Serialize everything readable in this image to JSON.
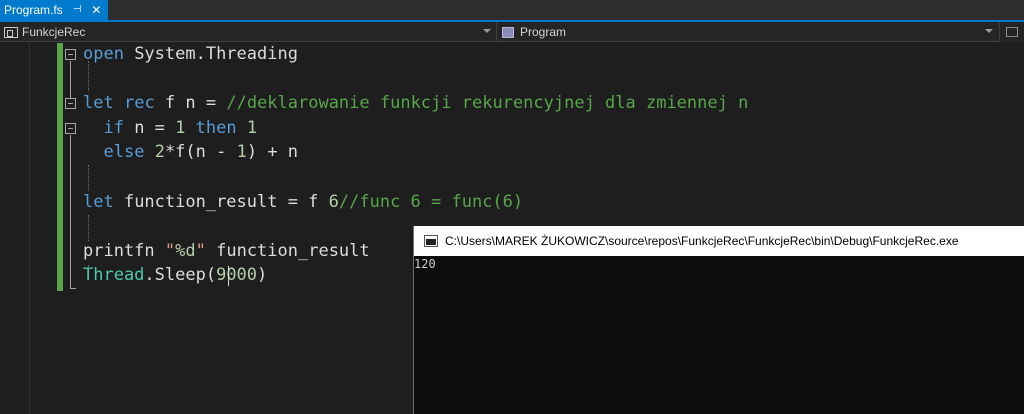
{
  "tab": {
    "label": "Program.fs",
    "pin_glyph": "⊣",
    "close_glyph": "✕",
    "active_color": "#007acc"
  },
  "navbar": {
    "left_label": "FunkcjeRec",
    "right_label": "Program",
    "left_icon": "fs-module-icon",
    "right_icon": "property-icon"
  },
  "code": {
    "lines": [
      {
        "segments": [
          [
            "kw",
            "open"
          ],
          [
            "pl",
            " System.Threading"
          ]
        ]
      },
      {
        "segments": []
      },
      {
        "segments": [
          [
            "kw",
            "let"
          ],
          [
            "pl",
            " "
          ],
          [
            "kw",
            "rec"
          ],
          [
            "pl",
            " f n = "
          ],
          [
            "cm",
            "//deklarowanie funkcji rekurencyjnej dla zmiennej n"
          ]
        ]
      },
      {
        "segments": [
          [
            "pl",
            "  "
          ],
          [
            "kw",
            "if"
          ],
          [
            "pl",
            " n = "
          ],
          [
            "num",
            "1"
          ],
          [
            "pl",
            " "
          ],
          [
            "kw",
            "then"
          ],
          [
            "pl",
            " "
          ],
          [
            "num",
            "1"
          ]
        ]
      },
      {
        "segments": [
          [
            "pl",
            "  "
          ],
          [
            "kw",
            "else"
          ],
          [
            "pl",
            " "
          ],
          [
            "num",
            "2"
          ],
          [
            "pl",
            "*f(n - "
          ],
          [
            "num",
            "1"
          ],
          [
            "pl",
            ") + n"
          ]
        ]
      },
      {
        "segments": []
      },
      {
        "segments": [
          [
            "kw",
            "let"
          ],
          [
            "pl",
            " function_result = f "
          ],
          [
            "num",
            "6"
          ],
          [
            "cm",
            "//func 6 = func(6)"
          ]
        ]
      },
      {
        "segments": []
      },
      {
        "segments": [
          [
            "pl",
            "printfn "
          ],
          [
            "str",
            "\""
          ],
          [
            "fmt",
            "%d"
          ],
          [
            "str",
            "\""
          ],
          [
            "pl",
            " function_result"
          ]
        ]
      },
      {
        "segments": [
          [
            "typ",
            "Thread"
          ],
          [
            "pl",
            ".Sleep("
          ],
          [
            "num",
            "9000"
          ],
          [
            "pl",
            ")"
          ]
        ]
      }
    ]
  },
  "console": {
    "title": "C:\\Users\\MAREK ŻUKOWICZ\\source\\repos\\FunkcjeRec\\FunkcjeRec\\bin\\Debug\\FunkcjeRec.exe",
    "output": "120"
  }
}
